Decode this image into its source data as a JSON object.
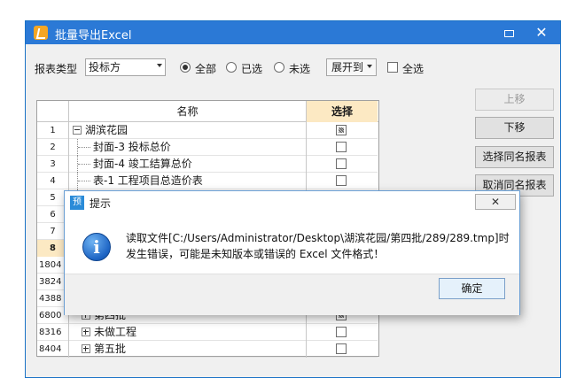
{
  "window": {
    "title": "批量导出Excel",
    "minimize_label": "",
    "close_label": "✕"
  },
  "toolbar": {
    "report_type_label": "报表类型",
    "report_type_value": "投标方",
    "radio_all": "全部",
    "radio_selected": "已选",
    "radio_unselected": "未选",
    "expand_label": "展开到",
    "select_all_label": "全选"
  },
  "grid": {
    "header_name": "名称",
    "header_select": "选择",
    "rows": [
      {
        "num": "1",
        "label": "湖滨花园",
        "checked": "partial"
      },
      {
        "num": "2",
        "label": "封面-3 投标总价",
        "checked": "no"
      },
      {
        "num": "3",
        "label": "封面-4 竣工结算总价",
        "checked": "no"
      },
      {
        "num": "4",
        "label": "表-1 工程项目总造价表",
        "checked": "no"
      },
      {
        "num": "5",
        "label": "",
        "checked": "no"
      },
      {
        "num": "6",
        "label": "",
        "checked": "no"
      },
      {
        "num": "7",
        "label": "",
        "checked": "no"
      },
      {
        "num": "8",
        "label": "",
        "checked": "no"
      },
      {
        "num": "1804",
        "label": "",
        "checked": "no"
      },
      {
        "num": "3824",
        "label": "",
        "checked": "no"
      },
      {
        "num": "4388",
        "label": "",
        "checked": "no"
      },
      {
        "num": "6800",
        "label": "第四批",
        "checked": "partial"
      },
      {
        "num": "8316",
        "label": "未做工程",
        "checked": "no"
      },
      {
        "num": "8404",
        "label": "第五批",
        "checked": "no"
      }
    ]
  },
  "side_buttons": {
    "move_up": "上移",
    "move_down": "下移",
    "select_same_name": "选择同名报表",
    "cancel_same_name": "取消同名报表"
  },
  "dialog": {
    "icon_label": "预",
    "title": "提示",
    "close_label": "✕",
    "message_line1": "读取文件[C:/Users/Administrator/Desktop\\湖滨花园/第四批/289/289.tmp]时",
    "message_line2": "发生错误，可能是未知版本或错误的 Excel 文件格式！",
    "ok_label": "确定"
  }
}
